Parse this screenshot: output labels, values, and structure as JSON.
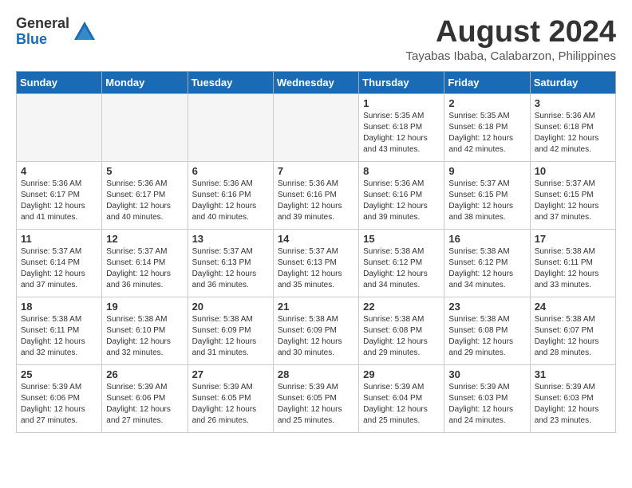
{
  "logo": {
    "general": "General",
    "blue": "Blue"
  },
  "title": {
    "month_year": "August 2024",
    "location": "Tayabas Ibaba, Calabarzon, Philippines"
  },
  "weekdays": [
    "Sunday",
    "Monday",
    "Tuesday",
    "Wednesday",
    "Thursday",
    "Friday",
    "Saturday"
  ],
  "weeks": [
    [
      {
        "day": "",
        "empty": true
      },
      {
        "day": "",
        "empty": true
      },
      {
        "day": "",
        "empty": true
      },
      {
        "day": "",
        "empty": true
      },
      {
        "day": "1",
        "sunrise": "5:35 AM",
        "sunset": "6:18 PM",
        "daylight": "12 hours and 43 minutes."
      },
      {
        "day": "2",
        "sunrise": "5:35 AM",
        "sunset": "6:18 PM",
        "daylight": "12 hours and 42 minutes."
      },
      {
        "day": "3",
        "sunrise": "5:36 AM",
        "sunset": "6:18 PM",
        "daylight": "12 hours and 42 minutes."
      }
    ],
    [
      {
        "day": "4",
        "sunrise": "5:36 AM",
        "sunset": "6:17 PM",
        "daylight": "12 hours and 41 minutes."
      },
      {
        "day": "5",
        "sunrise": "5:36 AM",
        "sunset": "6:17 PM",
        "daylight": "12 hours and 40 minutes."
      },
      {
        "day": "6",
        "sunrise": "5:36 AM",
        "sunset": "6:16 PM",
        "daylight": "12 hours and 40 minutes."
      },
      {
        "day": "7",
        "sunrise": "5:36 AM",
        "sunset": "6:16 PM",
        "daylight": "12 hours and 39 minutes."
      },
      {
        "day": "8",
        "sunrise": "5:36 AM",
        "sunset": "6:16 PM",
        "daylight": "12 hours and 39 minutes."
      },
      {
        "day": "9",
        "sunrise": "5:37 AM",
        "sunset": "6:15 PM",
        "daylight": "12 hours and 38 minutes."
      },
      {
        "day": "10",
        "sunrise": "5:37 AM",
        "sunset": "6:15 PM",
        "daylight": "12 hours and 37 minutes."
      }
    ],
    [
      {
        "day": "11",
        "sunrise": "5:37 AM",
        "sunset": "6:14 PM",
        "daylight": "12 hours and 37 minutes."
      },
      {
        "day": "12",
        "sunrise": "5:37 AM",
        "sunset": "6:14 PM",
        "daylight": "12 hours and 36 minutes."
      },
      {
        "day": "13",
        "sunrise": "5:37 AM",
        "sunset": "6:13 PM",
        "daylight": "12 hours and 36 minutes."
      },
      {
        "day": "14",
        "sunrise": "5:37 AM",
        "sunset": "6:13 PM",
        "daylight": "12 hours and 35 minutes."
      },
      {
        "day": "15",
        "sunrise": "5:38 AM",
        "sunset": "6:12 PM",
        "daylight": "12 hours and 34 minutes."
      },
      {
        "day": "16",
        "sunrise": "5:38 AM",
        "sunset": "6:12 PM",
        "daylight": "12 hours and 34 minutes."
      },
      {
        "day": "17",
        "sunrise": "5:38 AM",
        "sunset": "6:11 PM",
        "daylight": "12 hours and 33 minutes."
      }
    ],
    [
      {
        "day": "18",
        "sunrise": "5:38 AM",
        "sunset": "6:11 PM",
        "daylight": "12 hours and 32 minutes."
      },
      {
        "day": "19",
        "sunrise": "5:38 AM",
        "sunset": "6:10 PM",
        "daylight": "12 hours and 32 minutes."
      },
      {
        "day": "20",
        "sunrise": "5:38 AM",
        "sunset": "6:09 PM",
        "daylight": "12 hours and 31 minutes."
      },
      {
        "day": "21",
        "sunrise": "5:38 AM",
        "sunset": "6:09 PM",
        "daylight": "12 hours and 30 minutes."
      },
      {
        "day": "22",
        "sunrise": "5:38 AM",
        "sunset": "6:08 PM",
        "daylight": "12 hours and 29 minutes."
      },
      {
        "day": "23",
        "sunrise": "5:38 AM",
        "sunset": "6:08 PM",
        "daylight": "12 hours and 29 minutes."
      },
      {
        "day": "24",
        "sunrise": "5:38 AM",
        "sunset": "6:07 PM",
        "daylight": "12 hours and 28 minutes."
      }
    ],
    [
      {
        "day": "25",
        "sunrise": "5:39 AM",
        "sunset": "6:06 PM",
        "daylight": "12 hours and 27 minutes."
      },
      {
        "day": "26",
        "sunrise": "5:39 AM",
        "sunset": "6:06 PM",
        "daylight": "12 hours and 27 minutes."
      },
      {
        "day": "27",
        "sunrise": "5:39 AM",
        "sunset": "6:05 PM",
        "daylight": "12 hours and 26 minutes."
      },
      {
        "day": "28",
        "sunrise": "5:39 AM",
        "sunset": "6:05 PM",
        "daylight": "12 hours and 25 minutes."
      },
      {
        "day": "29",
        "sunrise": "5:39 AM",
        "sunset": "6:04 PM",
        "daylight": "12 hours and 25 minutes."
      },
      {
        "day": "30",
        "sunrise": "5:39 AM",
        "sunset": "6:03 PM",
        "daylight": "12 hours and 24 minutes."
      },
      {
        "day": "31",
        "sunrise": "5:39 AM",
        "sunset": "6:03 PM",
        "daylight": "12 hours and 23 minutes."
      }
    ]
  ]
}
